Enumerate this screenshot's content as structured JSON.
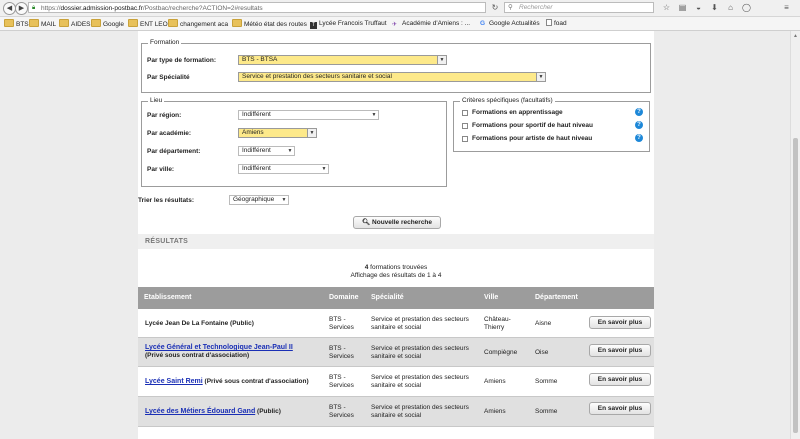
{
  "browser": {
    "url_prefix": "https://",
    "url_domain": "dossier.admission-postbac.fr",
    "url_path": "/Postbac/recherche?ACTION=2#resultats",
    "search_placeholder": "Rechercher",
    "bookmarks": [
      {
        "label": "BTS",
        "icon": "folder-icon"
      },
      {
        "label": "MAIL",
        "icon": "folder-icon"
      },
      {
        "label": "AIDES",
        "icon": "folder-icon"
      },
      {
        "label": "Google",
        "icon": "folder-icon"
      },
      {
        "label": "ENT LEO",
        "icon": "folder-icon"
      },
      {
        "label": "changement aca",
        "icon": "folder-icon"
      },
      {
        "label": "Météo état des routes",
        "icon": "folder-icon"
      },
      {
        "label": "Lycée Francois Truffaut",
        "icon": "favicon"
      },
      {
        "label": "Académie d'Amiens : ...",
        "icon": "academie-icon"
      },
      {
        "label": "Google Actualités",
        "icon": "google-icon"
      },
      {
        "label": "foad",
        "icon": "page-icon"
      }
    ]
  },
  "form": {
    "formation": {
      "legend": "Formation",
      "type_label": "Par type de formation:",
      "type_value": "BTS - BTSA",
      "spec_label": "Par Spécialité",
      "spec_value": "Service et prestation des secteurs sanitaire et social"
    },
    "lieu": {
      "legend": "Lieu",
      "region_label": "Par région:",
      "region_value": "Indifférent",
      "academie_label": "Par académie:",
      "academie_value": "Amiens",
      "departement_label": "Par département:",
      "departement_value": "Indifférent",
      "ville_label": "Par ville:",
      "ville_value": "Indifférent"
    },
    "criteres": {
      "legend": "Critères spécifiques (facultatifs)",
      "items": [
        "Formations en apprentissage",
        "Formations pour sportif de haut niveau",
        "Formations pour artiste de haut niveau"
      ]
    },
    "sort_label": "Trier les résultats:",
    "sort_value": "Géographique",
    "new_search_label": "Nouvelle recherche"
  },
  "results": {
    "title": "RÉSULTATS",
    "count_number": "4",
    "count_text": " formations trouvées",
    "display_text": "Affichage des résultats de 1 à 4",
    "columns": [
      "Etablissement",
      "Domaine",
      "Spécialité",
      "Ville",
      "Département"
    ],
    "more_label": "En savoir plus",
    "rows": [
      {
        "name": "Lycée Jean De La Fontaine",
        "status": "(Public)",
        "domaine": [
          "BTS -",
          "Services"
        ],
        "specialite": [
          "Service et prestation des secteurs",
          "sanitaire et social"
        ],
        "ville": [
          "Château-",
          "Thierry"
        ],
        "departement": "Aisne"
      },
      {
        "name": "Lycée Général et Technologique Jean-Paul II",
        "status": "(Privé sous contrat d'association)",
        "domaine": [
          "BTS -",
          "Services"
        ],
        "specialite": [
          "Service et prestation des secteurs",
          "sanitaire et social"
        ],
        "ville": [
          "Compiègne"
        ],
        "departement": "Oise"
      },
      {
        "name": "Lycée Saint Remi",
        "status": "(Privé sous contrat d'association)",
        "domaine": [
          "BTS -",
          "Services"
        ],
        "specialite": [
          "Service et prestation des secteurs",
          "sanitaire et social"
        ],
        "ville": [
          "Amiens"
        ],
        "departement": "Somme"
      },
      {
        "name": "Lycée des Métiers Édouard Gand",
        "status": "(Public)",
        "domaine": [
          "BTS -",
          "Services"
        ],
        "specialite": [
          "Service et prestation des secteurs",
          "sanitaire et social"
        ],
        "ville": [
          "Amiens"
        ],
        "departement": "Somme"
      }
    ]
  }
}
